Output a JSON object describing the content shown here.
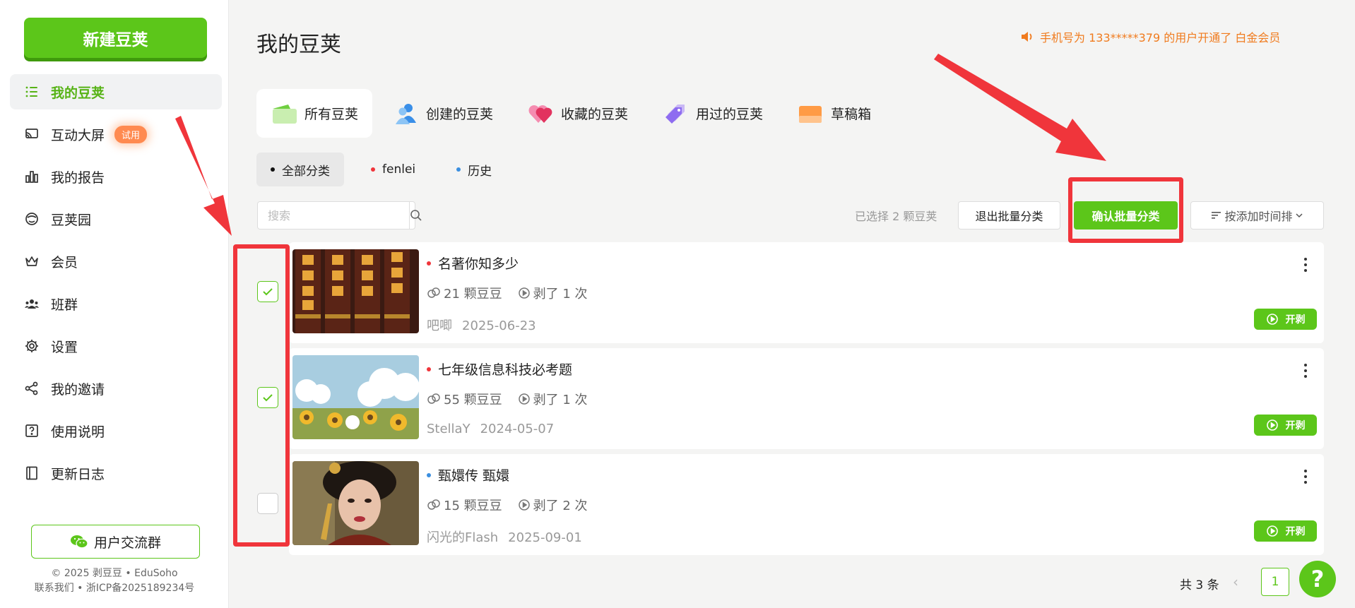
{
  "sidebar": {
    "new_button": "新建豆荚",
    "items": [
      {
        "label": "我的豆荚",
        "icon": "list-icon",
        "active": true
      },
      {
        "label": "互动大屏",
        "icon": "cast-screen-icon",
        "badge": "试用"
      },
      {
        "label": "我的报告",
        "icon": "bar-chart-icon"
      },
      {
        "label": "豆荚园",
        "icon": "bean-icon"
      },
      {
        "label": "会员",
        "icon": "crown-icon"
      },
      {
        "label": "班群",
        "icon": "group-icon"
      },
      {
        "label": "设置",
        "icon": "gear-icon"
      },
      {
        "label": "我的邀请",
        "icon": "share-icon"
      },
      {
        "label": "使用说明",
        "icon": "help-doc-icon"
      },
      {
        "label": "更新日志",
        "icon": "book-icon"
      }
    ],
    "community_button": "用户交流群",
    "copyright": "© 2025 剥豆豆 • EduSoho",
    "footer_links": "联系我们 • 浙ICP备2025189234号"
  },
  "header": {
    "title": "我的豆荚",
    "notice": "手机号为 133*****379 的用户开通了 白金会员"
  },
  "tabs": [
    {
      "label": "所有豆荚",
      "icon": "folder-green-icon",
      "active": true
    },
    {
      "label": "创建的豆荚",
      "icon": "users-blue-icon"
    },
    {
      "label": "收藏的豆荚",
      "icon": "heart-pink-icon"
    },
    {
      "label": "用过的豆荚",
      "icon": "tag-purple-icon"
    },
    {
      "label": "草稿箱",
      "icon": "drafts-orange-icon"
    }
  ],
  "categories": [
    {
      "label": "全部分类",
      "color": "#111111",
      "active": true
    },
    {
      "label": "fenlei",
      "color": "#f0353b"
    },
    {
      "label": "历史",
      "color": "#3b8fe0"
    }
  ],
  "toolbar": {
    "search_placeholder": "搜索",
    "selected_info": "已选择 2 颗豆荚",
    "exit_batch": "退出批量分类",
    "confirm_batch": "确认批量分类",
    "sort_label": "按添加时间排"
  },
  "cards": [
    {
      "title": "名著你知多少",
      "dot_color": "#f0353b",
      "beans": "21 颗豆豆",
      "plays": "剥了 1 次",
      "author": "吧唧",
      "date": "2025-06-23",
      "checked": true,
      "play_label": "开剥",
      "thumb": "books-thumb"
    },
    {
      "title": "七年级信息科技必考题",
      "dot_color": "#f0353b",
      "beans": "55 颗豆豆",
      "plays": "剥了 1 次",
      "author": "StellaY",
      "date": "2024-05-07",
      "checked": true,
      "play_label": "开剥",
      "thumb": "cartoon-thumb"
    },
    {
      "title": "甄嬛传 甄嬛",
      "dot_color": "#3b8fe0",
      "beans": "15 颗豆豆",
      "plays": "剥了 2 次",
      "author": "闪光的Flash",
      "date": "2025-09-01",
      "checked": false,
      "play_label": "开剥",
      "thumb": "portrait-thumb"
    }
  ],
  "pagination": {
    "total": "共 3 条",
    "current": "1",
    "help": "?"
  },
  "colors": {
    "brand": "#5cc61a",
    "accent_orange": "#f07b1e",
    "annotation_red": "#f0353b"
  }
}
